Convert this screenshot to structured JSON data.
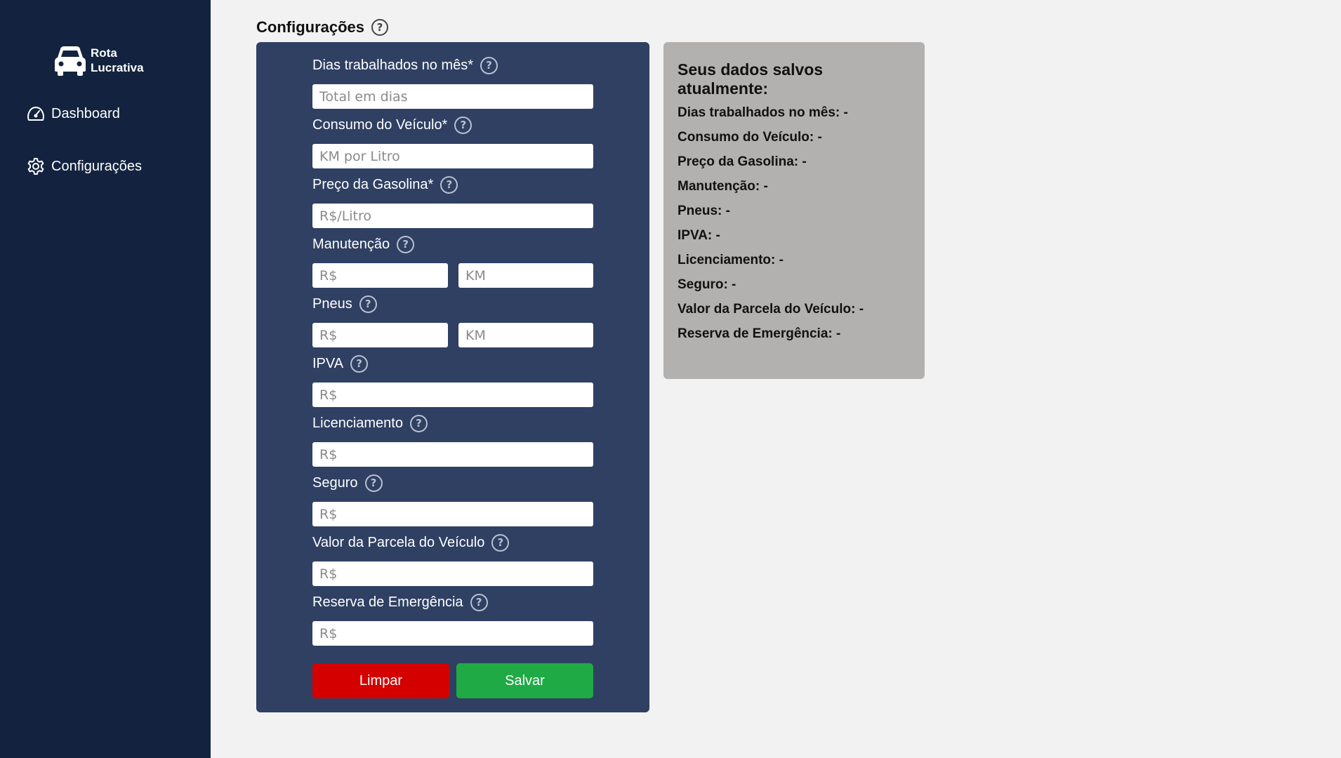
{
  "brand": {
    "line1": "Rota",
    "line2": "Lucrativa"
  },
  "sidebar": {
    "items": [
      {
        "label": "Dashboard",
        "icon": "dashboard-gauge-icon"
      },
      {
        "label": "Configurações",
        "icon": "gear-icon"
      }
    ]
  },
  "page": {
    "title": "Configurações"
  },
  "form": {
    "fields": [
      {
        "label": "Dias trabalhados no mês*",
        "placeholders": [
          "Total em dias"
        ]
      },
      {
        "label": "Consumo do Veículo*",
        "placeholders": [
          "KM por Litro"
        ]
      },
      {
        "label": "Preço da Gasolina*",
        "placeholders": [
          "R$/Litro"
        ]
      },
      {
        "label": "Manutenção",
        "placeholders": [
          "R$",
          "KM"
        ]
      },
      {
        "label": "Pneus",
        "placeholders": [
          "R$",
          "KM"
        ]
      },
      {
        "label": "IPVA",
        "placeholders": [
          "R$"
        ]
      },
      {
        "label": "Licenciamento",
        "placeholders": [
          "R$"
        ]
      },
      {
        "label": "Seguro",
        "placeholders": [
          "R$"
        ]
      },
      {
        "label": "Valor da Parcela do Veículo",
        "placeholders": [
          "R$"
        ]
      },
      {
        "label": "Reserva de Emergência",
        "placeholders": [
          "R$"
        ]
      }
    ],
    "clear_label": "Limpar",
    "save_label": "Salvar"
  },
  "saved": {
    "title": "Seus dados salvos atualmente:",
    "rows": [
      "Dias trabalhados no mês: -",
      "Consumo do Veículo: -",
      "Preço da Gasolina: -",
      "Manutenção: -",
      "Pneus: -",
      "IPVA: -",
      "Licenciamento: -",
      "Seguro: -",
      "Valor da Parcela do Veículo: -",
      "Reserva de Emergência: -"
    ]
  },
  "colors": {
    "sidebar_bg": "#13233f",
    "form_bg": "#2f4063",
    "saved_bg": "#b2b1b0",
    "clear_button": "#d40000",
    "save_button": "#1faa45"
  }
}
